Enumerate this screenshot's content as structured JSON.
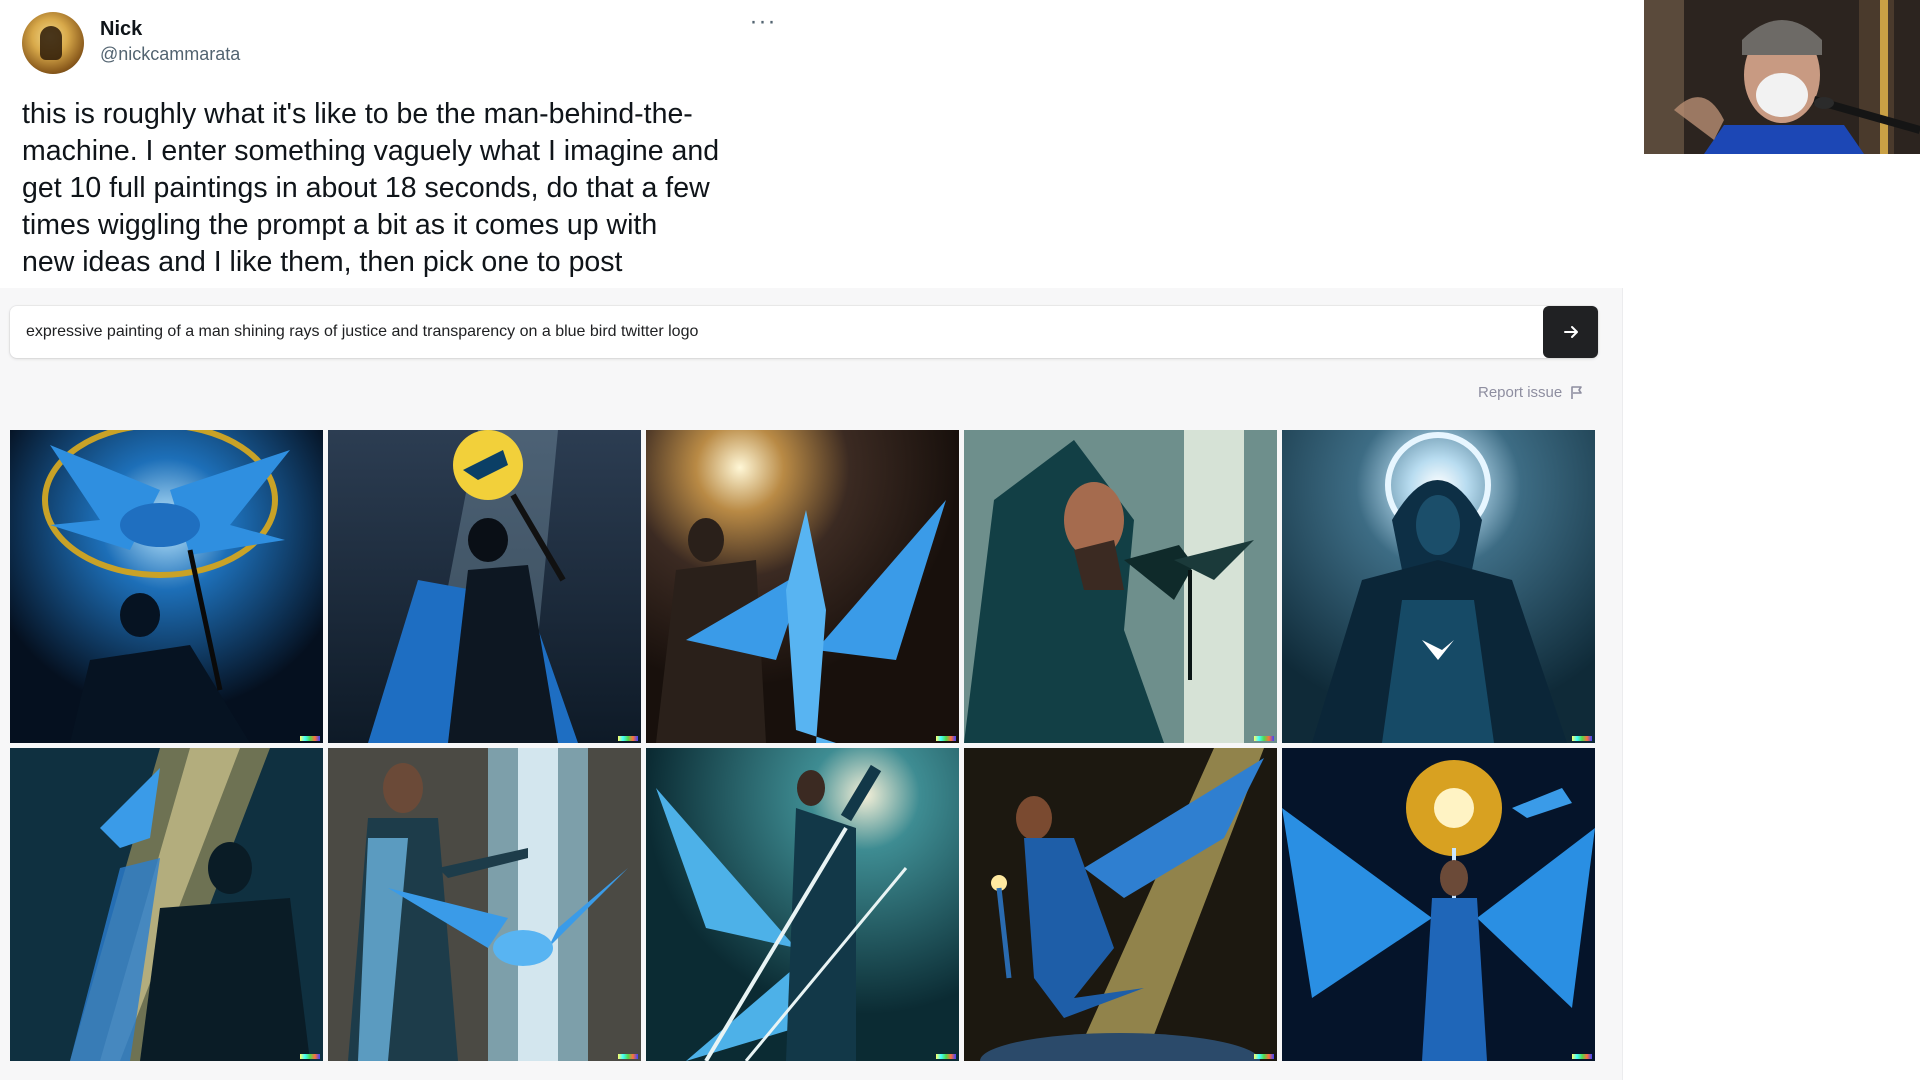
{
  "tweet": {
    "display_name": "Nick",
    "handle": "@nickcammarata",
    "more_label": "···",
    "text_lines": [
      "this is roughly what it's like to be the man-behind-the-",
      "machine. I enter something vaguely what I imagine and",
      "get 10 full paintings in about 18 seconds, do that a few",
      "times wiggling the prompt a bit as it comes up with",
      "new ideas and I like them, then pick one to post"
    ]
  },
  "dalle": {
    "prompt_value": "expressive painting of a man shining rays of justice and transparency on a blue bird twitter logo",
    "submit_icon": "arrow-right-icon",
    "report_issue_label": "Report issue",
    "report_issue_icon": "flag-icon",
    "watermark_colors": [
      "#ffff66",
      "#42ffff",
      "#51da4c",
      "#ff6e3c",
      "#3c46ff"
    ],
    "images": [
      {
        "description_icon": "generated-image"
      },
      {
        "description_icon": "generated-image"
      },
      {
        "description_icon": "generated-image"
      },
      {
        "description_icon": "generated-image"
      },
      {
        "description_icon": "generated-image"
      },
      {
        "description_icon": "generated-image"
      },
      {
        "description_icon": "generated-image"
      },
      {
        "description_icon": "generated-image"
      },
      {
        "description_icon": "generated-image"
      },
      {
        "description_icon": "generated-image"
      }
    ]
  },
  "colors": {
    "primary_text": "#0f1419",
    "secondary_text": "#536471",
    "panel_bg": "#f7f7f8",
    "button_dark": "#202123"
  }
}
